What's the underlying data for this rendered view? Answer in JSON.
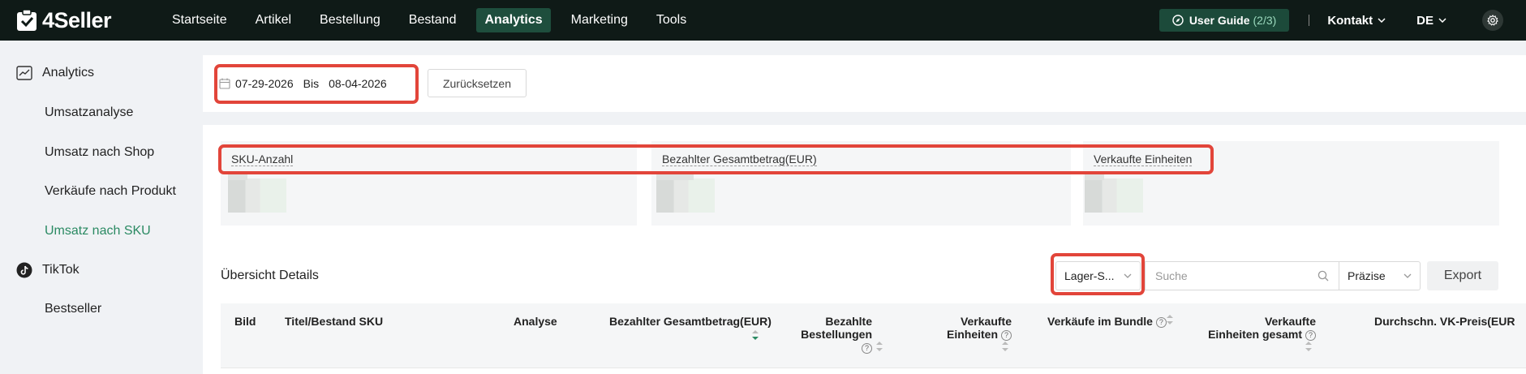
{
  "brand": {
    "name": "4Seller"
  },
  "nav": {
    "items": [
      "Startseite",
      "Artikel",
      "Bestellung",
      "Bestand",
      "Analytics",
      "Marketing",
      "Tools"
    ],
    "active": "Analytics",
    "guide_label": "User Guide",
    "guide_count": "(2/3)",
    "contact_label": "Kontakt",
    "language": "DE"
  },
  "sidebar": {
    "groups": [
      {
        "label": "Analytics",
        "icon": "chart-line-icon",
        "items": [
          "Umsatzanalyse",
          "Umsatz nach Shop",
          "Verkäufe nach Produkt",
          "Umsatz nach SKU"
        ]
      },
      {
        "label": "TikTok",
        "icon": "tiktok-icon",
        "items": [
          "Bestseller"
        ]
      }
    ],
    "active_item": "Umsatz nach SKU"
  },
  "filters": {
    "date_from": "07-29-2026",
    "date_separator": "Bis",
    "date_to": "08-04-2026",
    "reset_label": "Zurücksetzen"
  },
  "metrics": [
    {
      "label": "SKU-Anzahl"
    },
    {
      "label": "Bezahlter Gesamtbetrag(EUR)"
    },
    {
      "label": "Verkaufte Einheiten"
    }
  ],
  "details": {
    "title": "Übersicht Details",
    "warehouse_select": "Lager-S...",
    "search_placeholder": "Suche",
    "match_select": "Präzise",
    "export_label": "Export"
  },
  "table": {
    "columns": {
      "bild": "Bild",
      "titel": "Titel/Bestand SKU",
      "analyse": "Analyse",
      "betrag": "Bezahlter Gesamtbetrag(EUR)",
      "bestellungen_1": "Bezahlte",
      "bestellungen_2": "Bestellungen",
      "einheiten_1": "Verkaufte",
      "einheiten_2": "Einheiten",
      "bundle": "Verkäufe im Bundle",
      "gesamt_1": "Verkaufte",
      "gesamt_2": "Einheiten gesamt",
      "vkpreis": "Durchschn. VK-Preis(EUR"
    }
  },
  "colors": {
    "accent": "#2b8a63",
    "highlight": "#e2453a",
    "topbar": "#0f1a17"
  }
}
